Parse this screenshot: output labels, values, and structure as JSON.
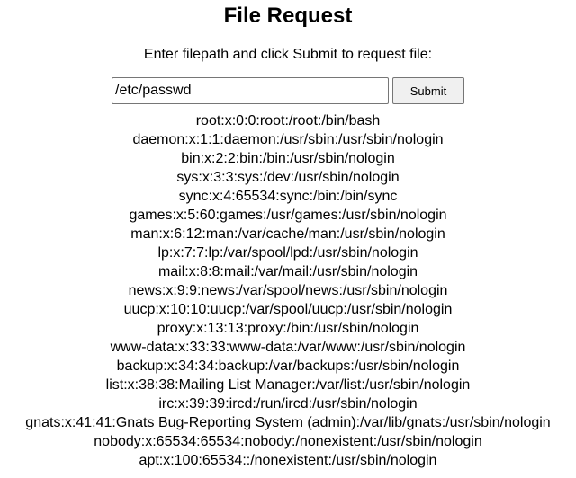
{
  "page": {
    "title": "File Request",
    "instructions": "Enter filepath and click Submit to request file:"
  },
  "form": {
    "filepath_value": "/etc/passwd",
    "submit_label": "Submit"
  },
  "output_lines": [
    "root:x:0:0:root:/root:/bin/bash",
    "daemon:x:1:1:daemon:/usr/sbin:/usr/sbin/nologin",
    "bin:x:2:2:bin:/bin:/usr/sbin/nologin",
    "sys:x:3:3:sys:/dev:/usr/sbin/nologin",
    "sync:x:4:65534:sync:/bin:/bin/sync",
    "games:x:5:60:games:/usr/games:/usr/sbin/nologin",
    "man:x:6:12:man:/var/cache/man:/usr/sbin/nologin",
    "lp:x:7:7:lp:/var/spool/lpd:/usr/sbin/nologin",
    "mail:x:8:8:mail:/var/mail:/usr/sbin/nologin",
    "news:x:9:9:news:/var/spool/news:/usr/sbin/nologin",
    "uucp:x:10:10:uucp:/var/spool/uucp:/usr/sbin/nologin",
    "proxy:x:13:13:proxy:/bin:/usr/sbin/nologin",
    "www-data:x:33:33:www-data:/var/www:/usr/sbin/nologin",
    "backup:x:34:34:backup:/var/backups:/usr/sbin/nologin",
    "list:x:38:38:Mailing List Manager:/var/list:/usr/sbin/nologin",
    "irc:x:39:39:ircd:/run/ircd:/usr/sbin/nologin",
    "gnats:x:41:41:Gnats Bug-Reporting System (admin):/var/lib/gnats:/usr/sbin/nologin",
    "nobody:x:65534:65534:nobody:/nonexistent:/usr/sbin/nologin",
    "apt:x:100:65534::/nonexistent:/usr/sbin/nologin"
  ]
}
